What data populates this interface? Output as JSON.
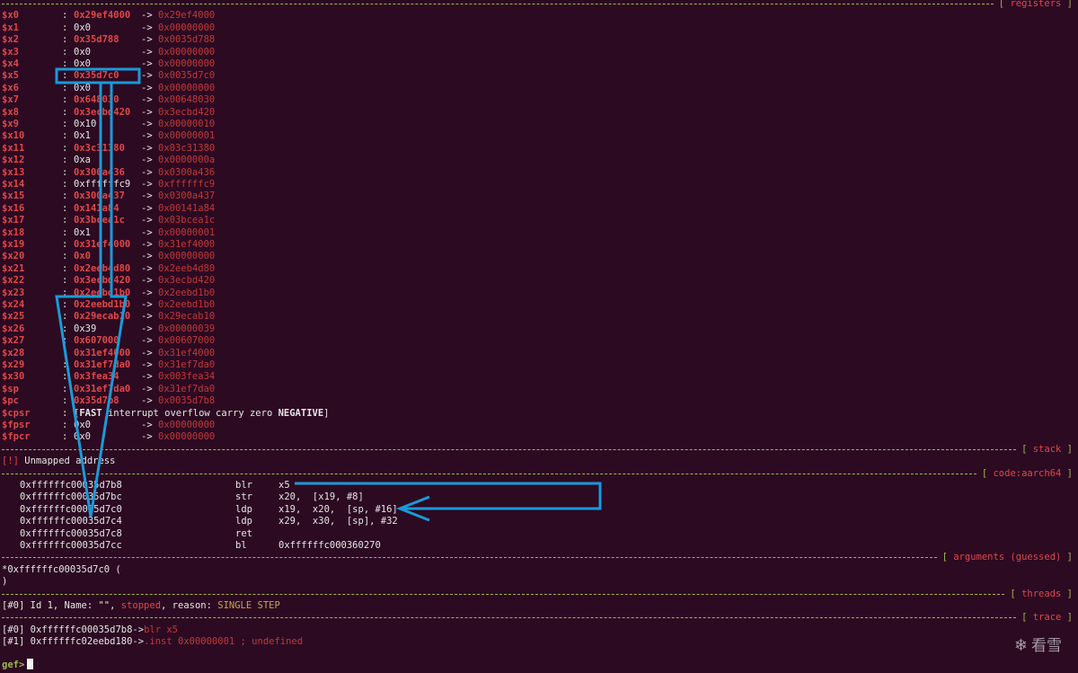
{
  "sections": {
    "registers": "registers",
    "stack": "stack",
    "code": "code:aarch64",
    "arguments": "arguments (guessed)",
    "threads": "threads",
    "trace": "trace"
  },
  "registers": [
    {
      "name": "$x0",
      "value": "0x29ef4000",
      "deref": "0x29ef4000",
      "hl": true
    },
    {
      "name": "$x1",
      "value": "0x0",
      "deref": "0x00000000",
      "hl": false
    },
    {
      "name": "$x2",
      "value": "0x35d788",
      "deref": "0x0035d788",
      "hl": true
    },
    {
      "name": "$x3",
      "value": "0x0",
      "deref": "0x00000000",
      "hl": false
    },
    {
      "name": "$x4",
      "value": "0x0",
      "deref": "0x00000000",
      "hl": false
    },
    {
      "name": "$x5",
      "value": "0x35d7c0",
      "deref": "0x0035d7c0",
      "hl": true
    },
    {
      "name": "$x6",
      "value": "0x0",
      "deref": "0x00000000",
      "hl": false
    },
    {
      "name": "$x7",
      "value": "0x648030",
      "deref": "0x00648030",
      "hl": true
    },
    {
      "name": "$x8",
      "value": "0x3ecbd420",
      "deref": "0x3ecbd420",
      "hl": true
    },
    {
      "name": "$x9",
      "value": "0x10",
      "deref": "0x00000010",
      "hl": false
    },
    {
      "name": "$x10",
      "value": "0x1",
      "deref": "0x00000001",
      "hl": false
    },
    {
      "name": "$x11",
      "value": "0x3c31380",
      "deref": "0x03c31380",
      "hl": true
    },
    {
      "name": "$x12",
      "value": "0xa",
      "deref": "0x0000000a",
      "hl": false
    },
    {
      "name": "$x13",
      "value": "0x300a436",
      "deref": "0x0300a436",
      "hl": true
    },
    {
      "name": "$x14",
      "value": "0xffffffc9",
      "deref": "0xffffffc9",
      "hl": false
    },
    {
      "name": "$x15",
      "value": "0x300a437",
      "deref": "0x0300a437",
      "hl": true
    },
    {
      "name": "$x16",
      "value": "0x141a84",
      "deref": "0x00141a84",
      "hl": true
    },
    {
      "name": "$x17",
      "value": "0x3bcea1c",
      "deref": "0x03bcea1c",
      "hl": true
    },
    {
      "name": "$x18",
      "value": "0x1",
      "deref": "0x00000001",
      "hl": false
    },
    {
      "name": "$x19",
      "value": "0x31ef4000",
      "deref": "0x31ef4000",
      "hl": true
    },
    {
      "name": "$x20",
      "value": "0x0",
      "deref": "0x00000000",
      "hl": true
    },
    {
      "name": "$x21",
      "value": "0x2eeb4d80",
      "deref": "0x2eeb4d80",
      "hl": true
    },
    {
      "name": "$x22",
      "value": "0x3ecbd420",
      "deref": "0x3ecbd420",
      "hl": true
    },
    {
      "name": "$x23",
      "value": "0x2eebd1b0",
      "deref": "0x2eebd1b0",
      "hl": true
    },
    {
      "name": "$x24",
      "value": "0x2eebd1b0",
      "deref": "0x2eebd1b0",
      "hl": true
    },
    {
      "name": "$x25",
      "value": "0x29ecab10",
      "deref": "0x29ecab10",
      "hl": true
    },
    {
      "name": "$x26",
      "value": "0x39",
      "deref": "0x00000039",
      "hl": false
    },
    {
      "name": "$x27",
      "value": "0x607000",
      "deref": "0x00607000",
      "hl": true
    },
    {
      "name": "$x28",
      "value": "0x31ef4000",
      "deref": "0x31ef4000",
      "hl": true
    },
    {
      "name": "$x29",
      "value": "0x31ef7da0",
      "deref": "0x31ef7da0",
      "hl": true
    },
    {
      "name": "$x30",
      "value": "0x3fea34",
      "deref": "0x003fea34",
      "hl": true
    },
    {
      "name": "$sp",
      "value": "0x31ef7da0",
      "deref": "0x31ef7da0",
      "hl": true
    },
    {
      "name": "$pc",
      "value": "0x35d7b8",
      "deref": "0x0035d7b8",
      "hl": true
    }
  ],
  "cpsr": {
    "name": "$cpsr",
    "open": "[",
    "fast": "FAST",
    "mid": " interrupt overflow carry zero ",
    "neg": "NEGATIVE",
    "close": "]"
  },
  "fp_registers": [
    {
      "name": "$fpsr",
      "value": "0x0",
      "deref": "0x00000000"
    },
    {
      "name": "$fpcr",
      "value": "0x0",
      "deref": "0x00000000"
    }
  ],
  "arrow": "->",
  "stack": {
    "tag": "[!]",
    "msg": " Unmapped address"
  },
  "code": [
    {
      "addr": "0xffffffc00035d7b8",
      "mn": "blr",
      "op": "x5"
    },
    {
      "addr": "0xffffffc00035d7bc",
      "mn": "str",
      "op": "x20,  [x19, #8]"
    },
    {
      "addr": "0xffffffc00035d7c0",
      "mn": "ldp",
      "op": "x19,  x20,  [sp, #16]"
    },
    {
      "addr": "0xffffffc00035d7c4",
      "mn": "ldp",
      "op": "x29,  x30,  [sp], #32"
    },
    {
      "addr": "0xffffffc00035d7c8",
      "mn": "ret",
      "op": ""
    },
    {
      "addr": "0xffffffc00035d7cc",
      "mn": "bl",
      "op": "0xffffffc000360270"
    }
  ],
  "arguments": {
    "line1": "*0xffffffc00035d7c0 (",
    "line2": ")"
  },
  "threads": {
    "idx": "[#0]",
    "text": " Id 1, Name: \"\", ",
    "stopped": "stopped",
    "mid": ", reason: ",
    "reason": "SINGLE STEP"
  },
  "trace": [
    {
      "idx": "[#0]",
      "addr": " 0xffffffc00035d7b8->",
      "sym": "blr x5"
    },
    {
      "idx": "[#1]",
      "addr": " 0xffffffc02eebd180->",
      "sym": ".inst 0x00000001 ; undefined"
    }
  ],
  "prompt": "gef>",
  "watermark": "看雪",
  "colors": {
    "bg": "#2c0a22",
    "red": "#e04848",
    "green": "#9db84a",
    "annotation": "#1a9ad8"
  }
}
